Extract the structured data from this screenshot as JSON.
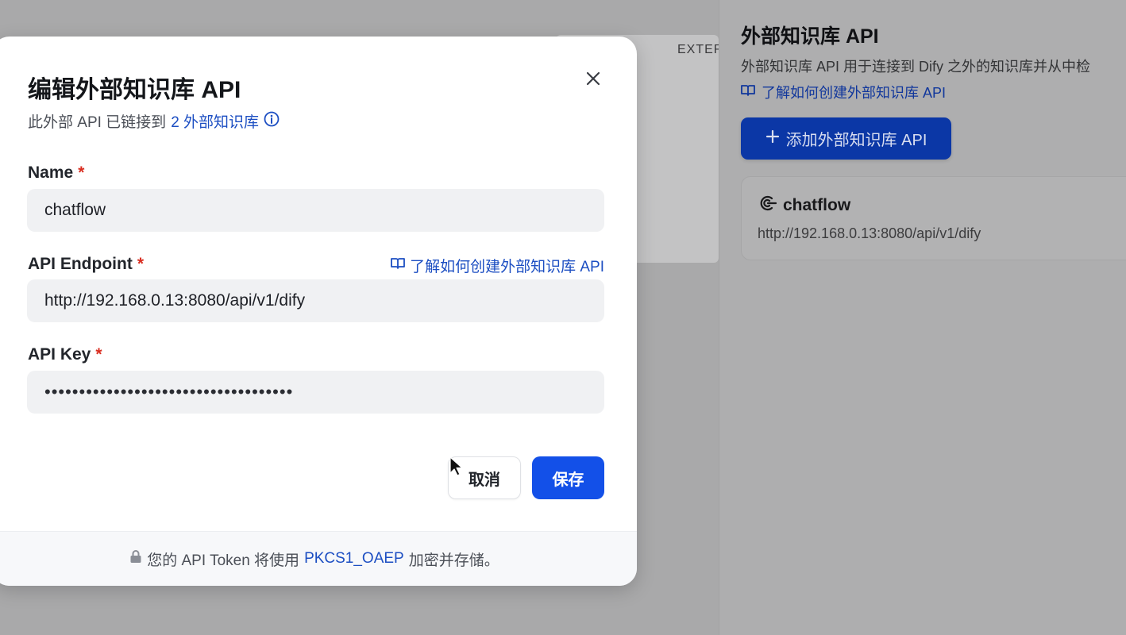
{
  "background": {
    "tab_label": "EXTERN"
  },
  "side_panel": {
    "title": "外部知识库 API",
    "description": "外部知识库 API 用于连接到 Dify 之外的知识库并从中检",
    "help_link": "了解如何创建外部知识库 API",
    "add_button": "添加外部知识库 API",
    "card": {
      "name": "chatflow",
      "url": "http://192.168.0.13:8080/api/v1/dify"
    }
  },
  "modal": {
    "title": "编辑外部知识库 API",
    "subtitle_prefix": "此外部 API 已链接到",
    "subtitle_link": "2 外部知识库",
    "name_label": "Name",
    "name_value": "chatflow",
    "endpoint_label": "API Endpoint",
    "endpoint_help": "了解如何创建外部知识库 API",
    "endpoint_value": "http://192.168.0.13:8080/api/v1/dify",
    "key_label": "API Key",
    "key_value": "••••••••••••••••••••••••••••••••••••",
    "required_mark": "*",
    "cancel_label": "取消",
    "save_label": "保存",
    "footer_prefix": "您的 API Token 将使用",
    "footer_link": "PKCS1_OAEP",
    "footer_suffix": "加密并存储。"
  },
  "colors": {
    "primary": "#1350e8",
    "link": "#1c4ec2",
    "required": "#d92d20"
  },
  "icons": [
    "close-icon",
    "info-icon",
    "book-icon",
    "plus-icon",
    "api-icon",
    "lock-icon",
    "cursor-icon"
  ]
}
